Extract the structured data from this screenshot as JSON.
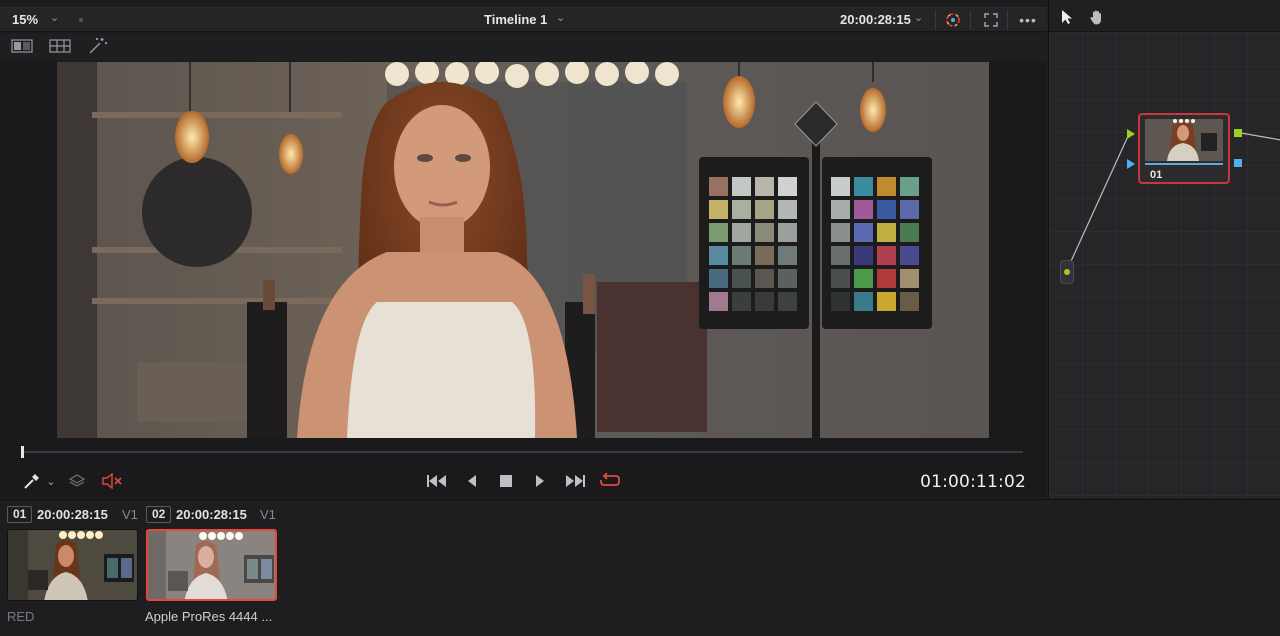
{
  "viewer": {
    "zoom": "15%",
    "timeline_title": "Timeline 1",
    "source_timecode": "20:00:28:15",
    "playback_timecode": "01:00:11:02"
  },
  "node_graph": {
    "node_label": "01",
    "node_border_color": "#c8383a",
    "input_color": "#9ad023",
    "output_rgb_color": "#9ad023",
    "output_alpha_color": "#4bb1ef"
  },
  "clips": [
    {
      "number": "01",
      "timecode": "20:00:28:15",
      "track": "V1",
      "name": "RED",
      "selected": false
    },
    {
      "number": "02",
      "timecode": "20:00:28:15",
      "track": "V1",
      "name": "Apple ProRes 4444 ...",
      "selected": true
    }
  ],
  "colors": {
    "accent_red": "#e8473c",
    "panel_bg": "#1f1f22"
  }
}
